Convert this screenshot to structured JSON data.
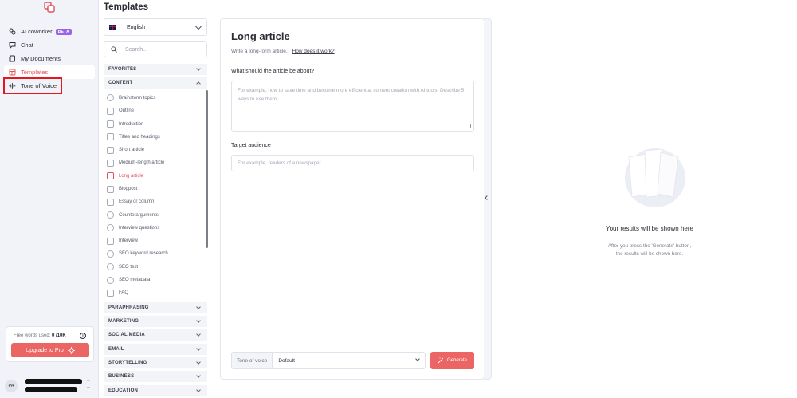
{
  "sidebar": {
    "items": [
      {
        "label": "AI coworker",
        "icon": "ai-coworker-icon",
        "badge": "BETA"
      },
      {
        "label": "Chat",
        "icon": "chat-icon"
      },
      {
        "label": "My Documents",
        "icon": "documents-icon"
      },
      {
        "label": "Templates",
        "icon": "templates-icon",
        "active": true
      },
      {
        "label": "Tone of Voice",
        "icon": "tone-of-voice-icon"
      }
    ],
    "plan": {
      "words_label": "Free words used:",
      "words_value": "0 /10K",
      "upgrade_label": "Upgrade to Pro"
    },
    "user": {
      "initials": "PA"
    }
  },
  "templates": {
    "title": "Templates",
    "language": "English",
    "search_placeholder": "Search...",
    "favorites_label": "FAVORITES",
    "content_label": "CONTENT",
    "content_items": [
      "Brainstorm topics",
      "Outline",
      "Introduction",
      "Titles and headings",
      "Short article",
      "Medium-length article",
      "Long article",
      "Blogpost",
      "Essay or column",
      "Counterarguments",
      "Interview questions",
      "Interview",
      "SEO keyword research",
      "SEO text",
      "SEO metadata",
      "FAQ"
    ],
    "active_item": "Long article",
    "categories": [
      "PARAPHRASING",
      "MARKETING",
      "SOCIAL MEDIA",
      "EMAIL",
      "STORYTELLING",
      "BUSINESS",
      "EDUCATION"
    ]
  },
  "form": {
    "title": "Long article",
    "subtitle": "Write a long-form article.",
    "help_link": "How does it work?",
    "field1_label": "What should the article be about?",
    "field1_placeholder": "For example, how to save time and become more efficient at content creation with AI tools. Describe 5 ways to use them.",
    "field2_label": "Target audience",
    "field2_placeholder": "For example, readers of a newspaper",
    "tone_label": "Tone of voice",
    "tone_value": "Default",
    "generate_label": "Generate"
  },
  "results": {
    "title": "Your results will be shown here",
    "line1": "After you press the 'Generate' button,",
    "line2": "the results will be shown here."
  },
  "colors": {
    "accent": "#ec6565",
    "beta": "#9b63e8",
    "highlight": "#e3171e"
  }
}
